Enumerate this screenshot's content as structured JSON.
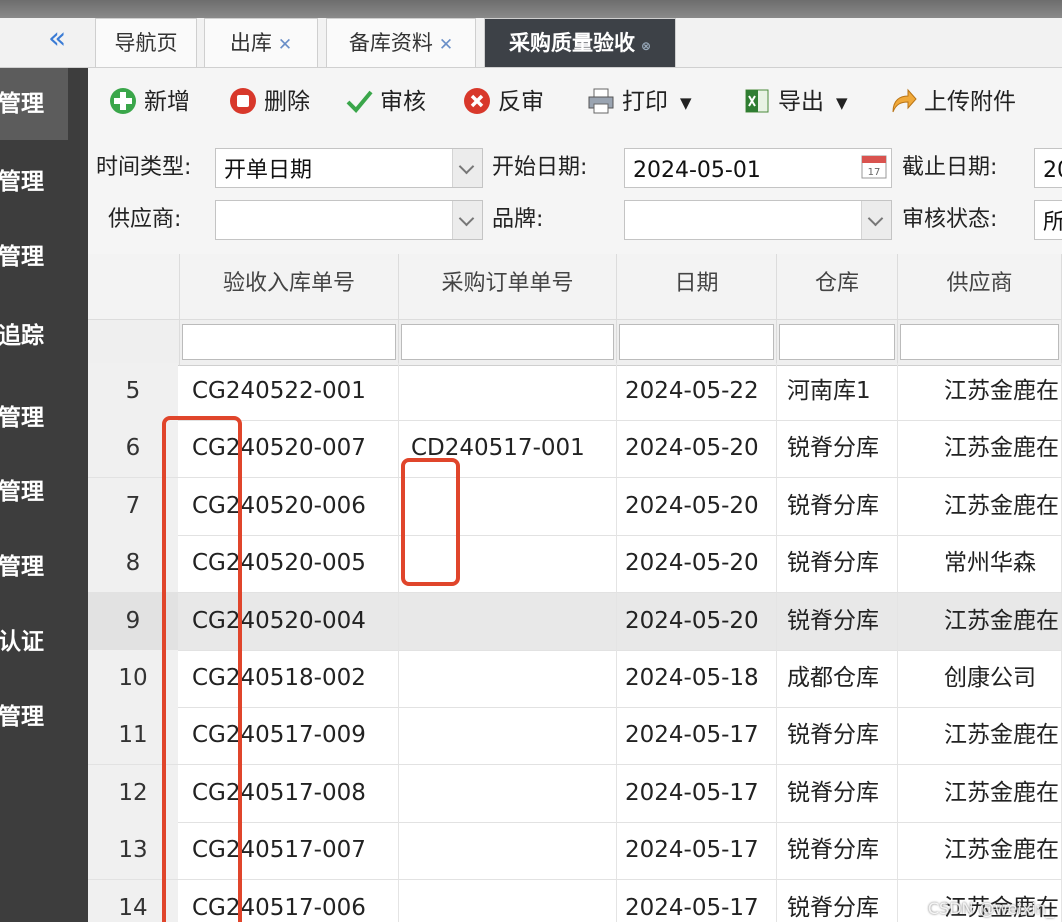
{
  "tabs": [
    {
      "label": "导航页",
      "closable": false,
      "active": false
    },
    {
      "label": "出库",
      "closable": true,
      "active": false
    },
    {
      "label": "备库资料",
      "closable": true,
      "active": false
    },
    {
      "label": "采购质量验收",
      "closable": true,
      "active": true
    }
  ],
  "sidebar": {
    "items": [
      {
        "label": "管理",
        "active": true
      },
      {
        "label": "管理",
        "active": false
      },
      {
        "label": "管理",
        "active": false
      },
      {
        "label": "追踪",
        "active": false
      },
      {
        "label": "管理",
        "active": false
      },
      {
        "label": "管理",
        "active": false
      },
      {
        "label": "管理",
        "active": false
      },
      {
        "label": "认证",
        "active": false
      },
      {
        "label": "管理",
        "active": false
      }
    ]
  },
  "toolbar": {
    "add_label": "新增",
    "delete_label": "删除",
    "audit_label": "审核",
    "unaudit_label": "反审",
    "print_label": "打印",
    "export_label": "导出",
    "upload_label": "上传附件"
  },
  "filters": {
    "time_type_label": "时间类型:",
    "time_type_value": "开单日期",
    "start_date_label": "开始日期:",
    "start_date_value": "2024-05-01",
    "end_date_label": "截止日期:",
    "end_date_value": "20",
    "supplier_label": "供应商:",
    "supplier_value": "",
    "brand_label": "品牌:",
    "brand_value": "",
    "audit_status_label": "审核状态:",
    "audit_status_value": "所"
  },
  "table": {
    "columns": [
      "验收入库单号",
      "采购订单单号",
      "日期",
      "仓库",
      "供应商"
    ],
    "rows": [
      {
        "num": "5",
        "receipt_no": "CG240522-001",
        "po_no": "",
        "date": "2024-05-22",
        "warehouse": "河南库1",
        "supplier": "江苏金鹿在"
      },
      {
        "num": "6",
        "receipt_no": "CG240520-007",
        "po_no": "CD240517-001",
        "date": "2024-05-20",
        "warehouse": "锐脊分库",
        "supplier": "江苏金鹿在"
      },
      {
        "num": "7",
        "receipt_no": "CG240520-006",
        "po_no": "",
        "date": "2024-05-20",
        "warehouse": "锐脊分库",
        "supplier": "江苏金鹿在"
      },
      {
        "num": "8",
        "receipt_no": "CG240520-005",
        "po_no": "",
        "date": "2024-05-20",
        "warehouse": "锐脊分库",
        "supplier": "常州华森"
      },
      {
        "num": "9",
        "receipt_no": "CG240520-004",
        "po_no": "",
        "date": "2024-05-20",
        "warehouse": "锐脊分库",
        "supplier": "江苏金鹿在"
      },
      {
        "num": "10",
        "receipt_no": "CG240518-002",
        "po_no": "",
        "date": "2024-05-18",
        "warehouse": "成都仓库",
        "supplier": "创康公司"
      },
      {
        "num": "11",
        "receipt_no": "CG240517-009",
        "po_no": "",
        "date": "2024-05-17",
        "warehouse": "锐脊分库",
        "supplier": "江苏金鹿在"
      },
      {
        "num": "12",
        "receipt_no": "CG240517-008",
        "po_no": "",
        "date": "2024-05-17",
        "warehouse": "锐脊分库",
        "supplier": "江苏金鹿在"
      },
      {
        "num": "13",
        "receipt_no": "CG240517-007",
        "po_no": "",
        "date": "2024-05-17",
        "warehouse": "锐脊分库",
        "supplier": "江苏金鹿在"
      },
      {
        "num": "14",
        "receipt_no": "CG240517-006",
        "po_no": "",
        "date": "2024-05-17",
        "warehouse": "锐脊分库",
        "supplier": "江苏金鹿在"
      }
    ],
    "selected_row": "9"
  },
  "watermark": "CSDN @weixin_"
}
